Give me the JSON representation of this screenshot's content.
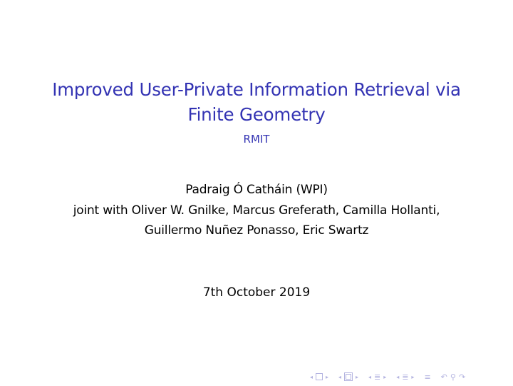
{
  "slide": {
    "title_line1": "Improved User-Private Information Retrieval via",
    "title_line2": "Finite Geometry",
    "institute": "RMIT",
    "author_line1": "Padraig Ó Catháin (WPI)",
    "author_line2": "joint with Oliver W. Gnilke, Marcus Greferath, Camilla Hollanti,",
    "author_line3": "Guillermo Nuñez Ponasso, Eric Swartz",
    "date": "7th October 2019"
  },
  "navigation": {
    "icons": [
      "frame-nav-icon",
      "subsection-nav-icon",
      "section-nav-icon",
      "part-nav-icon",
      "align-icon",
      "search-back-forward-icon"
    ],
    "glyphs": {
      "left": "◂",
      "right": "▸",
      "section": "≣",
      "align": "≡",
      "back": "↶",
      "search": "⚲",
      "forward": "↷"
    }
  },
  "colors": {
    "title": "#3333b3",
    "nav": "#b3b3e0",
    "text": "#000000"
  }
}
